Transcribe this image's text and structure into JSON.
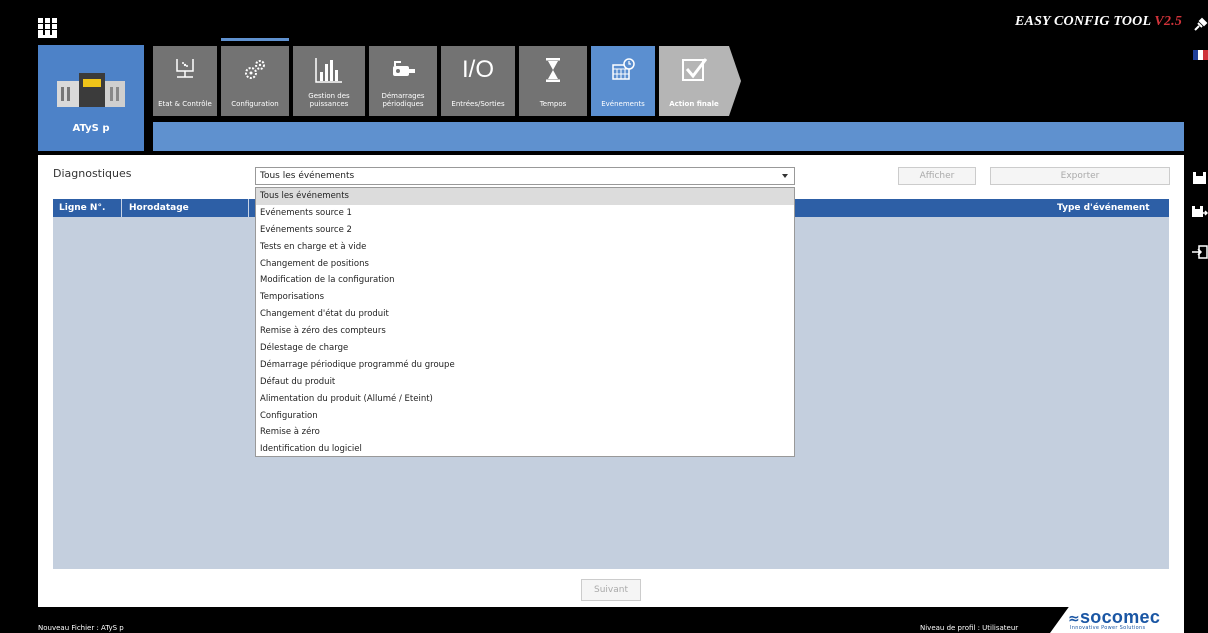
{
  "app": {
    "title": "EASY CONFIG TOOL ",
    "version": "V2.5",
    "product_name": "ATyS p"
  },
  "tabs": [
    {
      "label": "Etat & Contrôle",
      "icon": "state-control-icon"
    },
    {
      "label": "Configuration",
      "icon": "gears-icon"
    },
    {
      "label": "Gestion des puissances",
      "icon": "bar-chart-icon"
    },
    {
      "label": "Démarrages périodiques",
      "icon": "motor-icon"
    },
    {
      "label": "Entrées/Sorties",
      "icon": "io-icon"
    },
    {
      "label": "Tempos",
      "icon": "hourglass-icon"
    },
    {
      "label": "Evénements",
      "icon": "calendar-event-icon",
      "active": true
    },
    {
      "label": "Action finale",
      "icon": "checkmark-icon"
    }
  ],
  "main": {
    "section_label": "Diagnostiques",
    "filter_select": {
      "value": "Tous les événements",
      "options": [
        "Tous les événements",
        "Evénements source 1",
        "Evénements source 2",
        "Tests en charge et à vide",
        "Changement de positions",
        "Modification de la configuration",
        "Temporisations",
        "Changement d'état du produit",
        "Remise à zéro des compteurs",
        "Délestage de charge",
        "Démarrage périodique programmé du groupe",
        "Défaut du produit",
        "Alimentation du produit (Allumé / Eteint)",
        "Configuration",
        "Remise à zéro",
        "Identification du logiciel"
      ]
    },
    "afficher_label": "Afficher",
    "exporter_label": "Exporter",
    "table_headers": {
      "line_no": "Ligne N°.",
      "timestamp": "Horodatage",
      "event_type": "Type d'événement"
    },
    "next_label": "Suivant"
  },
  "footer": {
    "file": "Nouveau Fichier : ATyS p",
    "profile": "Niveau de profil : Utilisateur",
    "logo": "socomec",
    "logo_mark": "≈",
    "tagline": "Innovative Power Solutions"
  },
  "colors": {
    "accent_blue": "#5f91cf",
    "header_blue": "#2d5fa6",
    "version_red": "#d0333a"
  }
}
